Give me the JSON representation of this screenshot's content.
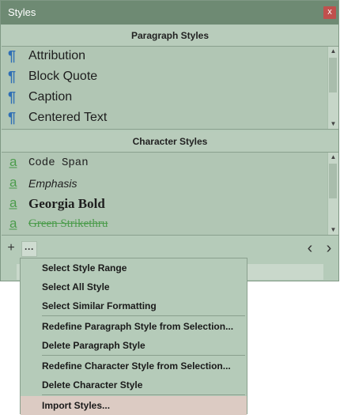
{
  "window": {
    "title": "Styles",
    "close_label": "x"
  },
  "paragraph_styles": {
    "header": "Paragraph Styles",
    "items": [
      {
        "label": "Attribution"
      },
      {
        "label": "Block Quote"
      },
      {
        "label": "Caption"
      },
      {
        "label": "Centered Text"
      }
    ]
  },
  "character_styles": {
    "header": "Character Styles",
    "items": [
      {
        "label": "Code Span"
      },
      {
        "label": "Emphasis"
      },
      {
        "label": "Georgia Bold"
      },
      {
        "label": "Green Strikethru"
      }
    ]
  },
  "toolbar": {
    "add": "+",
    "more": "···",
    "prev": "‹",
    "next": "›"
  },
  "context_menu": {
    "items": [
      {
        "label": "Select Style Range"
      },
      {
        "label": "Select All Style"
      },
      {
        "label": "Select Similar Formatting"
      },
      {
        "label": "Redefine Paragraph Style from Selection..."
      },
      {
        "label": "Delete Paragraph Style"
      },
      {
        "label": "Redefine Character Style from Selection..."
      },
      {
        "label": "Delete Character Style"
      },
      {
        "label": "Import Styles..."
      }
    ]
  },
  "icons": {
    "paragraph_style_icon": "pilcrow-icon",
    "character_style_icon": "char-a-icon"
  },
  "colors": {
    "accent_green": "#4c9c4c",
    "paragraph_icon_blue": "#2f6fb5",
    "menu_hover": "#dccbc3"
  }
}
